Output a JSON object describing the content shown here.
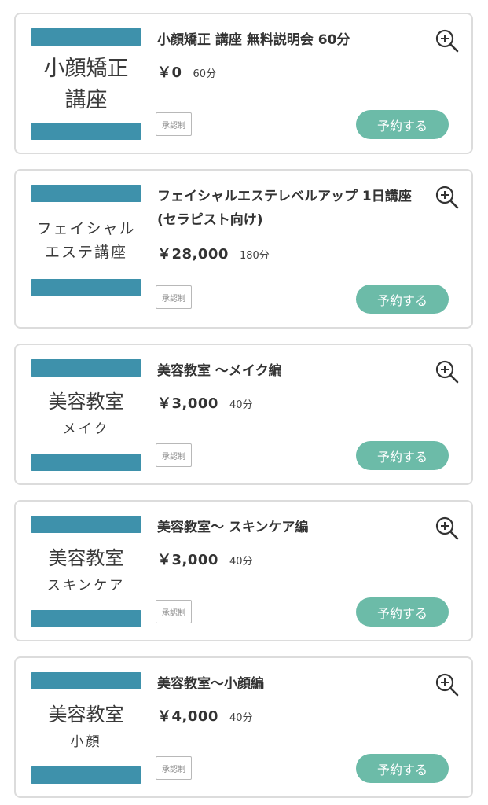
{
  "courses": [
    {
      "thumb_lines": [
        "小顔矯正",
        "講座"
      ],
      "title": "小顔矯正 講座 無料説明会 60分",
      "price": "￥0",
      "duration": "60分",
      "badge": "承認制",
      "button": "予約する"
    },
    {
      "thumb_lines": [
        "フェイシャル",
        "エステ講座"
      ],
      "title": "フェイシャルエステレベルアップ 1日講座 (セラピスト向け)",
      "price": "￥28,000",
      "duration": "180分",
      "badge": "承認制",
      "button": "予約する"
    },
    {
      "thumb_lines": [
        "美容教室",
        "メイク"
      ],
      "title": "美容教室 〜メイク編",
      "price": "￥3,000",
      "duration": "40分",
      "badge": "承認制",
      "button": "予約する"
    },
    {
      "thumb_lines": [
        "美容教室",
        "スキンケア"
      ],
      "title": "美容教室〜 スキンケア編",
      "price": "￥3,000",
      "duration": "40分",
      "badge": "承認制",
      "button": "予約する"
    },
    {
      "thumb_lines": [
        "美容教室",
        "小顔"
      ],
      "title": "美容教室〜小顔編",
      "price": "￥4,000",
      "duration": "40分",
      "badge": "承認制",
      "button": "予約する"
    }
  ],
  "icons": {
    "zoom": "zoom-in-icon"
  },
  "colors": {
    "thumb_bar": "#3e91ab",
    "reserve_button": "#6cbba8",
    "card_border": "#dcdcdc"
  }
}
